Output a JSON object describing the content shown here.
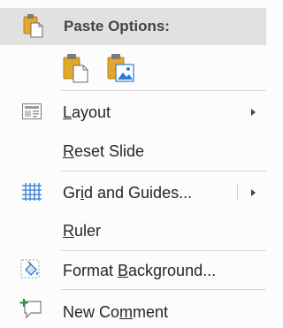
{
  "menu": {
    "paste_options_label": "Paste Options:",
    "paste_buttons": [
      {
        "name": "paste-use-destination-theme",
        "icon": "clipboard-doc-icon"
      },
      {
        "name": "paste-as-picture",
        "icon": "clipboard-picture-icon"
      }
    ],
    "items": [
      {
        "id": "layout",
        "pre": "",
        "key": "L",
        "post": "ayout",
        "submenu": true
      },
      {
        "id": "reset-slide",
        "pre": "",
        "key": "R",
        "post": "eset Slide",
        "submenu": false
      },
      {
        "id": "grid-and-guides",
        "pre": "Gr",
        "key": "i",
        "post": "d and Guides...",
        "submenu": true
      },
      {
        "id": "ruler",
        "pre": "",
        "key": "R",
        "post": "uler",
        "submenu": false
      },
      {
        "id": "format-background",
        "pre": "Format ",
        "key": "B",
        "post": "ackground...",
        "submenu": false
      },
      {
        "id": "new-comment",
        "pre": "New Co",
        "key": "m",
        "post": "ment",
        "submenu": false
      }
    ]
  },
  "colors": {
    "accent": "#2b7cd3",
    "clipboard_gold": "#e3a72b",
    "header_bg": "#e1e1e1"
  }
}
